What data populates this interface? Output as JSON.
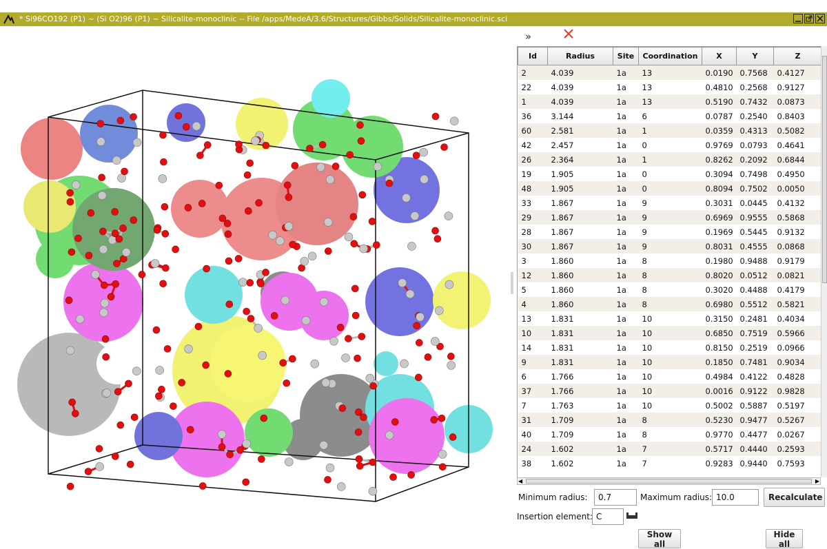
{
  "window": {
    "title": "* Si96CO192  (P1) ~ (Si O2)96  (P1) ~ Silicalite-monoclinic -- File /apps/MedeA/3.6/Structures/Gibbs/Solids/Silicalite-monoclinic.sci"
  },
  "icons": {
    "app": "app-logo-icon",
    "minimize": "minimize-icon",
    "maximize": "maximize-icon",
    "close": "close-icon",
    "collapse": "double-chevron-right-icon",
    "delete": "red-x-icon",
    "element_picker": "periodic-table-icon"
  },
  "colors": {
    "titlebar": "#b2ab2b",
    "row_alt": "#f3eee8",
    "delete_icon": "#e8392d"
  },
  "panel": {
    "collapse_glyph": "»"
  },
  "table": {
    "columns": [
      "Id",
      "Radius",
      "Site",
      "Coordination",
      "X",
      "Y",
      "Z"
    ],
    "rows": [
      [
        "2",
        "4.039",
        "1a",
        "13",
        "0.0190",
        "0.7568",
        "0.4127"
      ],
      [
        "22",
        "4.039",
        "1a",
        "13",
        "0.4810",
        "0.2568",
        "0.9127"
      ],
      [
        "1",
        "4.039",
        "1a",
        "13",
        "0.5190",
        "0.7432",
        "0.0873"
      ],
      [
        "36",
        "3.144",
        "1a",
        "6",
        "0.0787",
        "0.2540",
        "0.8403"
      ],
      [
        "60",
        "2.581",
        "1a",
        "1",
        "0.0359",
        "0.4313",
        "0.5082"
      ],
      [
        "42",
        "2.457",
        "1a",
        "0",
        "0.9769",
        "0.0793",
        "0.4641"
      ],
      [
        "26",
        "2.364",
        "1a",
        "1",
        "0.8262",
        "0.2092",
        "0.6844"
      ],
      [
        "19",
        "1.905",
        "1a",
        "0",
        "0.3094",
        "0.7498",
        "0.4950"
      ],
      [
        "48",
        "1.905",
        "1a",
        "0",
        "0.8094",
        "0.7502",
        "0.0050"
      ],
      [
        "33",
        "1.867",
        "1a",
        "9",
        "0.3031",
        "0.0445",
        "0.4132"
      ],
      [
        "29",
        "1.867",
        "1a",
        "9",
        "0.6969",
        "0.9555",
        "0.5868"
      ],
      [
        "28",
        "1.867",
        "1a",
        "9",
        "0.1969",
        "0.5445",
        "0.9132"
      ],
      [
        "30",
        "1.867",
        "1a",
        "9",
        "0.8031",
        "0.4555",
        "0.0868"
      ],
      [
        "3",
        "1.860",
        "1a",
        "8",
        "0.1980",
        "0.9488",
        "0.9179"
      ],
      [
        "12",
        "1.860",
        "1a",
        "8",
        "0.8020",
        "0.0512",
        "0.0821"
      ],
      [
        "5",
        "1.860",
        "1a",
        "8",
        "0.3020",
        "0.4488",
        "0.4179"
      ],
      [
        "4",
        "1.860",
        "1a",
        "8",
        "0.6980",
        "0.5512",
        "0.5821"
      ],
      [
        "13",
        "1.831",
        "1a",
        "10",
        "0.3150",
        "0.2481",
        "0.4034"
      ],
      [
        "10",
        "1.831",
        "1a",
        "10",
        "0.6850",
        "0.7519",
        "0.5966"
      ],
      [
        "14",
        "1.831",
        "1a",
        "10",
        "0.8150",
        "0.2519",
        "0.0966"
      ],
      [
        "9",
        "1.831",
        "1a",
        "10",
        "0.1850",
        "0.7481",
        "0.9034"
      ],
      [
        "6",
        "1.766",
        "1a",
        "10",
        "0.4984",
        "0.4122",
        "0.4828"
      ],
      [
        "37",
        "1.766",
        "1a",
        "10",
        "0.0016",
        "0.9122",
        "0.9828"
      ],
      [
        "7",
        "1.763",
        "1a",
        "10",
        "0.5002",
        "0.5887",
        "0.5197"
      ],
      [
        "31",
        "1.709",
        "1a",
        "8",
        "0.5230",
        "0.9477",
        "0.5267"
      ],
      [
        "40",
        "1.709",
        "1a",
        "8",
        "0.9770",
        "0.4477",
        "0.0267"
      ],
      [
        "24",
        "1.602",
        "1a",
        "7",
        "0.5717",
        "0.4440",
        "0.2593"
      ],
      [
        "38",
        "1.602",
        "1a",
        "7",
        "0.9283",
        "0.9440",
        "0.7593"
      ]
    ]
  },
  "controls": {
    "min_radius_label": "Minimum radius:",
    "min_radius_value": "0.7",
    "max_radius_label": "Maximum radius:",
    "max_radius_value": "10.0",
    "recalculate_label": "Recalculate",
    "insertion_label": "Insertion element:",
    "insertion_value": "C",
    "show_all_label": "Show all",
    "hide_all_label": "Hide all"
  }
}
